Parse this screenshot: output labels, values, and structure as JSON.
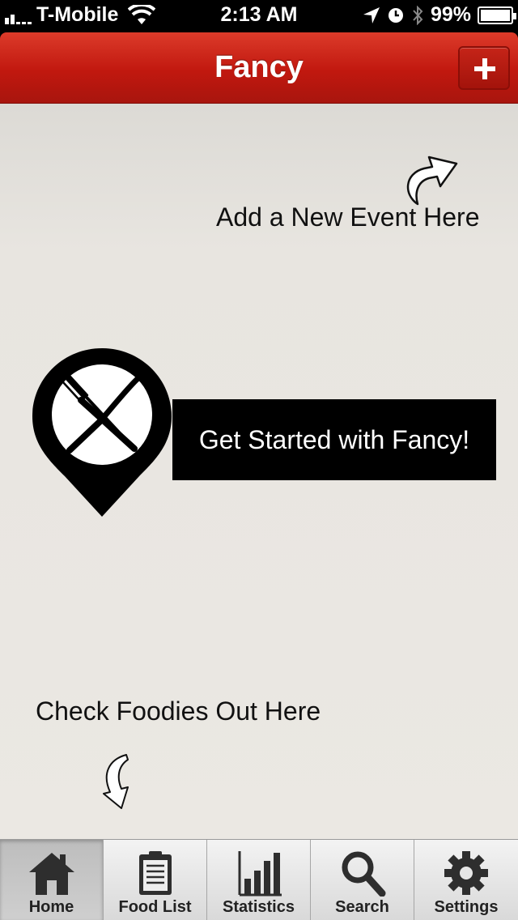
{
  "status_bar": {
    "carrier": "T-Mobile",
    "time": "2:13 AM",
    "battery": "99%"
  },
  "nav": {
    "title": "Fancy",
    "add_button_icon": "plus-icon"
  },
  "content": {
    "hint_add_event": "Add a New Event Here",
    "cta_label": "Get Started with Fancy!",
    "hint_foodies": "Check Foodies Out Here",
    "logo_icon": "fork-knife-location-pin"
  },
  "tabs": [
    {
      "label": "Home",
      "icon": "home-icon",
      "active": true
    },
    {
      "label": "Food List",
      "icon": "clipboard-icon",
      "active": false
    },
    {
      "label": "Statistics",
      "icon": "bar-chart-icon",
      "active": false
    },
    {
      "label": "Search",
      "icon": "search-icon",
      "active": false
    },
    {
      "label": "Settings",
      "icon": "gear-icon",
      "active": false
    }
  ],
  "colors": {
    "nav_red": "#c1180f",
    "background": "#e8e5e0"
  }
}
